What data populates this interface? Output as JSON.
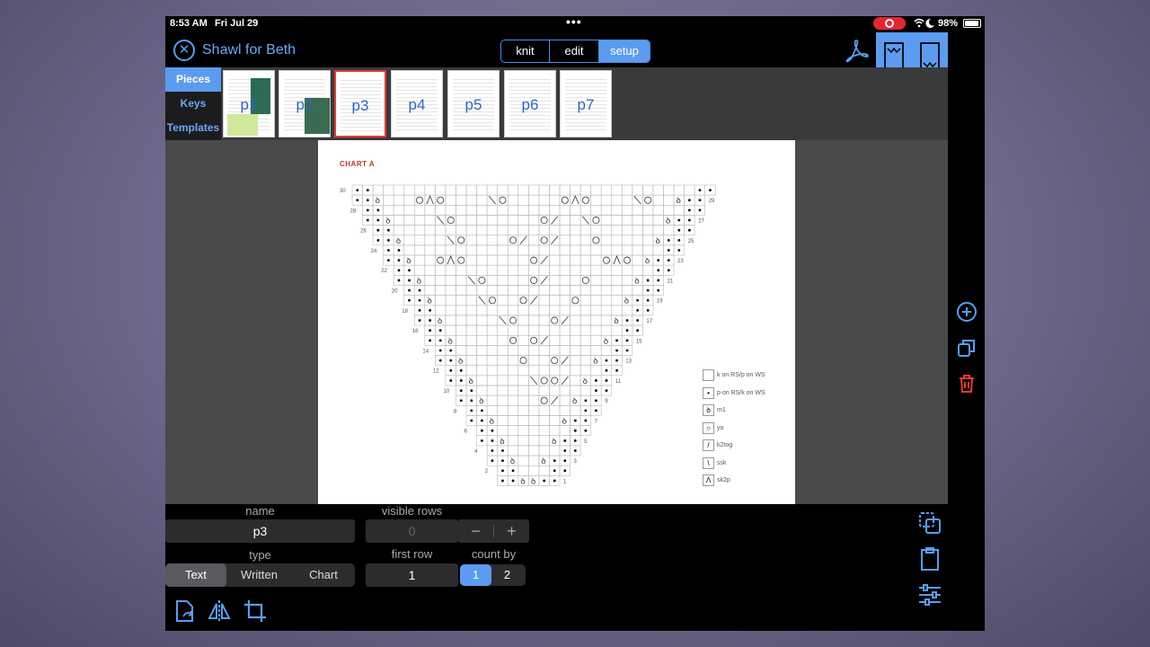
{
  "status": {
    "time": "8:53 AM",
    "date": "Fri Jul 29",
    "battery": "98%"
  },
  "header": {
    "title": "Shawl for Beth",
    "modes": [
      {
        "label": "knit",
        "active": false
      },
      {
        "label": "edit",
        "active": false
      },
      {
        "label": "setup",
        "active": true
      }
    ]
  },
  "sidebar": {
    "tabs": [
      {
        "label": "Pieces",
        "active": true
      },
      {
        "label": "Keys",
        "active": false
      },
      {
        "label": "Templates",
        "active": false
      }
    ]
  },
  "pieces": [
    {
      "label": "p1",
      "selected": false
    },
    {
      "label": "p2",
      "selected": false
    },
    {
      "label": "p3",
      "selected": true
    },
    {
      "label": "p4",
      "selected": false
    },
    {
      "label": "p5",
      "selected": false
    },
    {
      "label": "p6",
      "selected": false
    },
    {
      "label": "p7",
      "selected": false
    }
  ],
  "document": {
    "chart_title": "CHART A",
    "row_numbers_left": [
      "30",
      "28",
      "26",
      "24",
      "22",
      "20",
      "18",
      "16",
      "14",
      "12",
      "10",
      "8",
      "6",
      "4",
      "2"
    ],
    "row_numbers_right": [
      "29",
      "27",
      "25",
      "23",
      "21",
      "19",
      "17",
      "15",
      "13",
      "11",
      "9",
      "7",
      "5",
      "3",
      "1"
    ],
    "legend": [
      {
        "symbol": "",
        "text": "k on RS/p on WS"
      },
      {
        "symbol": "•",
        "text": "p on RS/k on WS"
      },
      {
        "symbol": "ꝺ",
        "text": "m1"
      },
      {
        "symbol": "○",
        "text": "yo"
      },
      {
        "symbol": "/",
        "text": "k2tog"
      },
      {
        "symbol": "\\",
        "text": "ssk"
      },
      {
        "symbol": "Λ",
        "text": "sk2p"
      }
    ]
  },
  "form": {
    "name_label": "name",
    "name_value": "p3",
    "visible_rows_label": "visible rows",
    "visible_rows_value": "0",
    "minus": "−",
    "plus": "+",
    "type_label": "type",
    "type_options": [
      {
        "label": "Text",
        "active": true
      },
      {
        "label": "Written",
        "active": false
      },
      {
        "label": "Chart",
        "active": false
      }
    ],
    "first_row_label": "first row",
    "first_row_value": "1",
    "count_by_label": "count by",
    "count_by_options": [
      {
        "label": "1",
        "active": true
      },
      {
        "label": "2",
        "active": false
      }
    ]
  },
  "colors": {
    "accent": "#5b9cf0",
    "danger": "#e53935",
    "panel": "#2c2c2e"
  }
}
